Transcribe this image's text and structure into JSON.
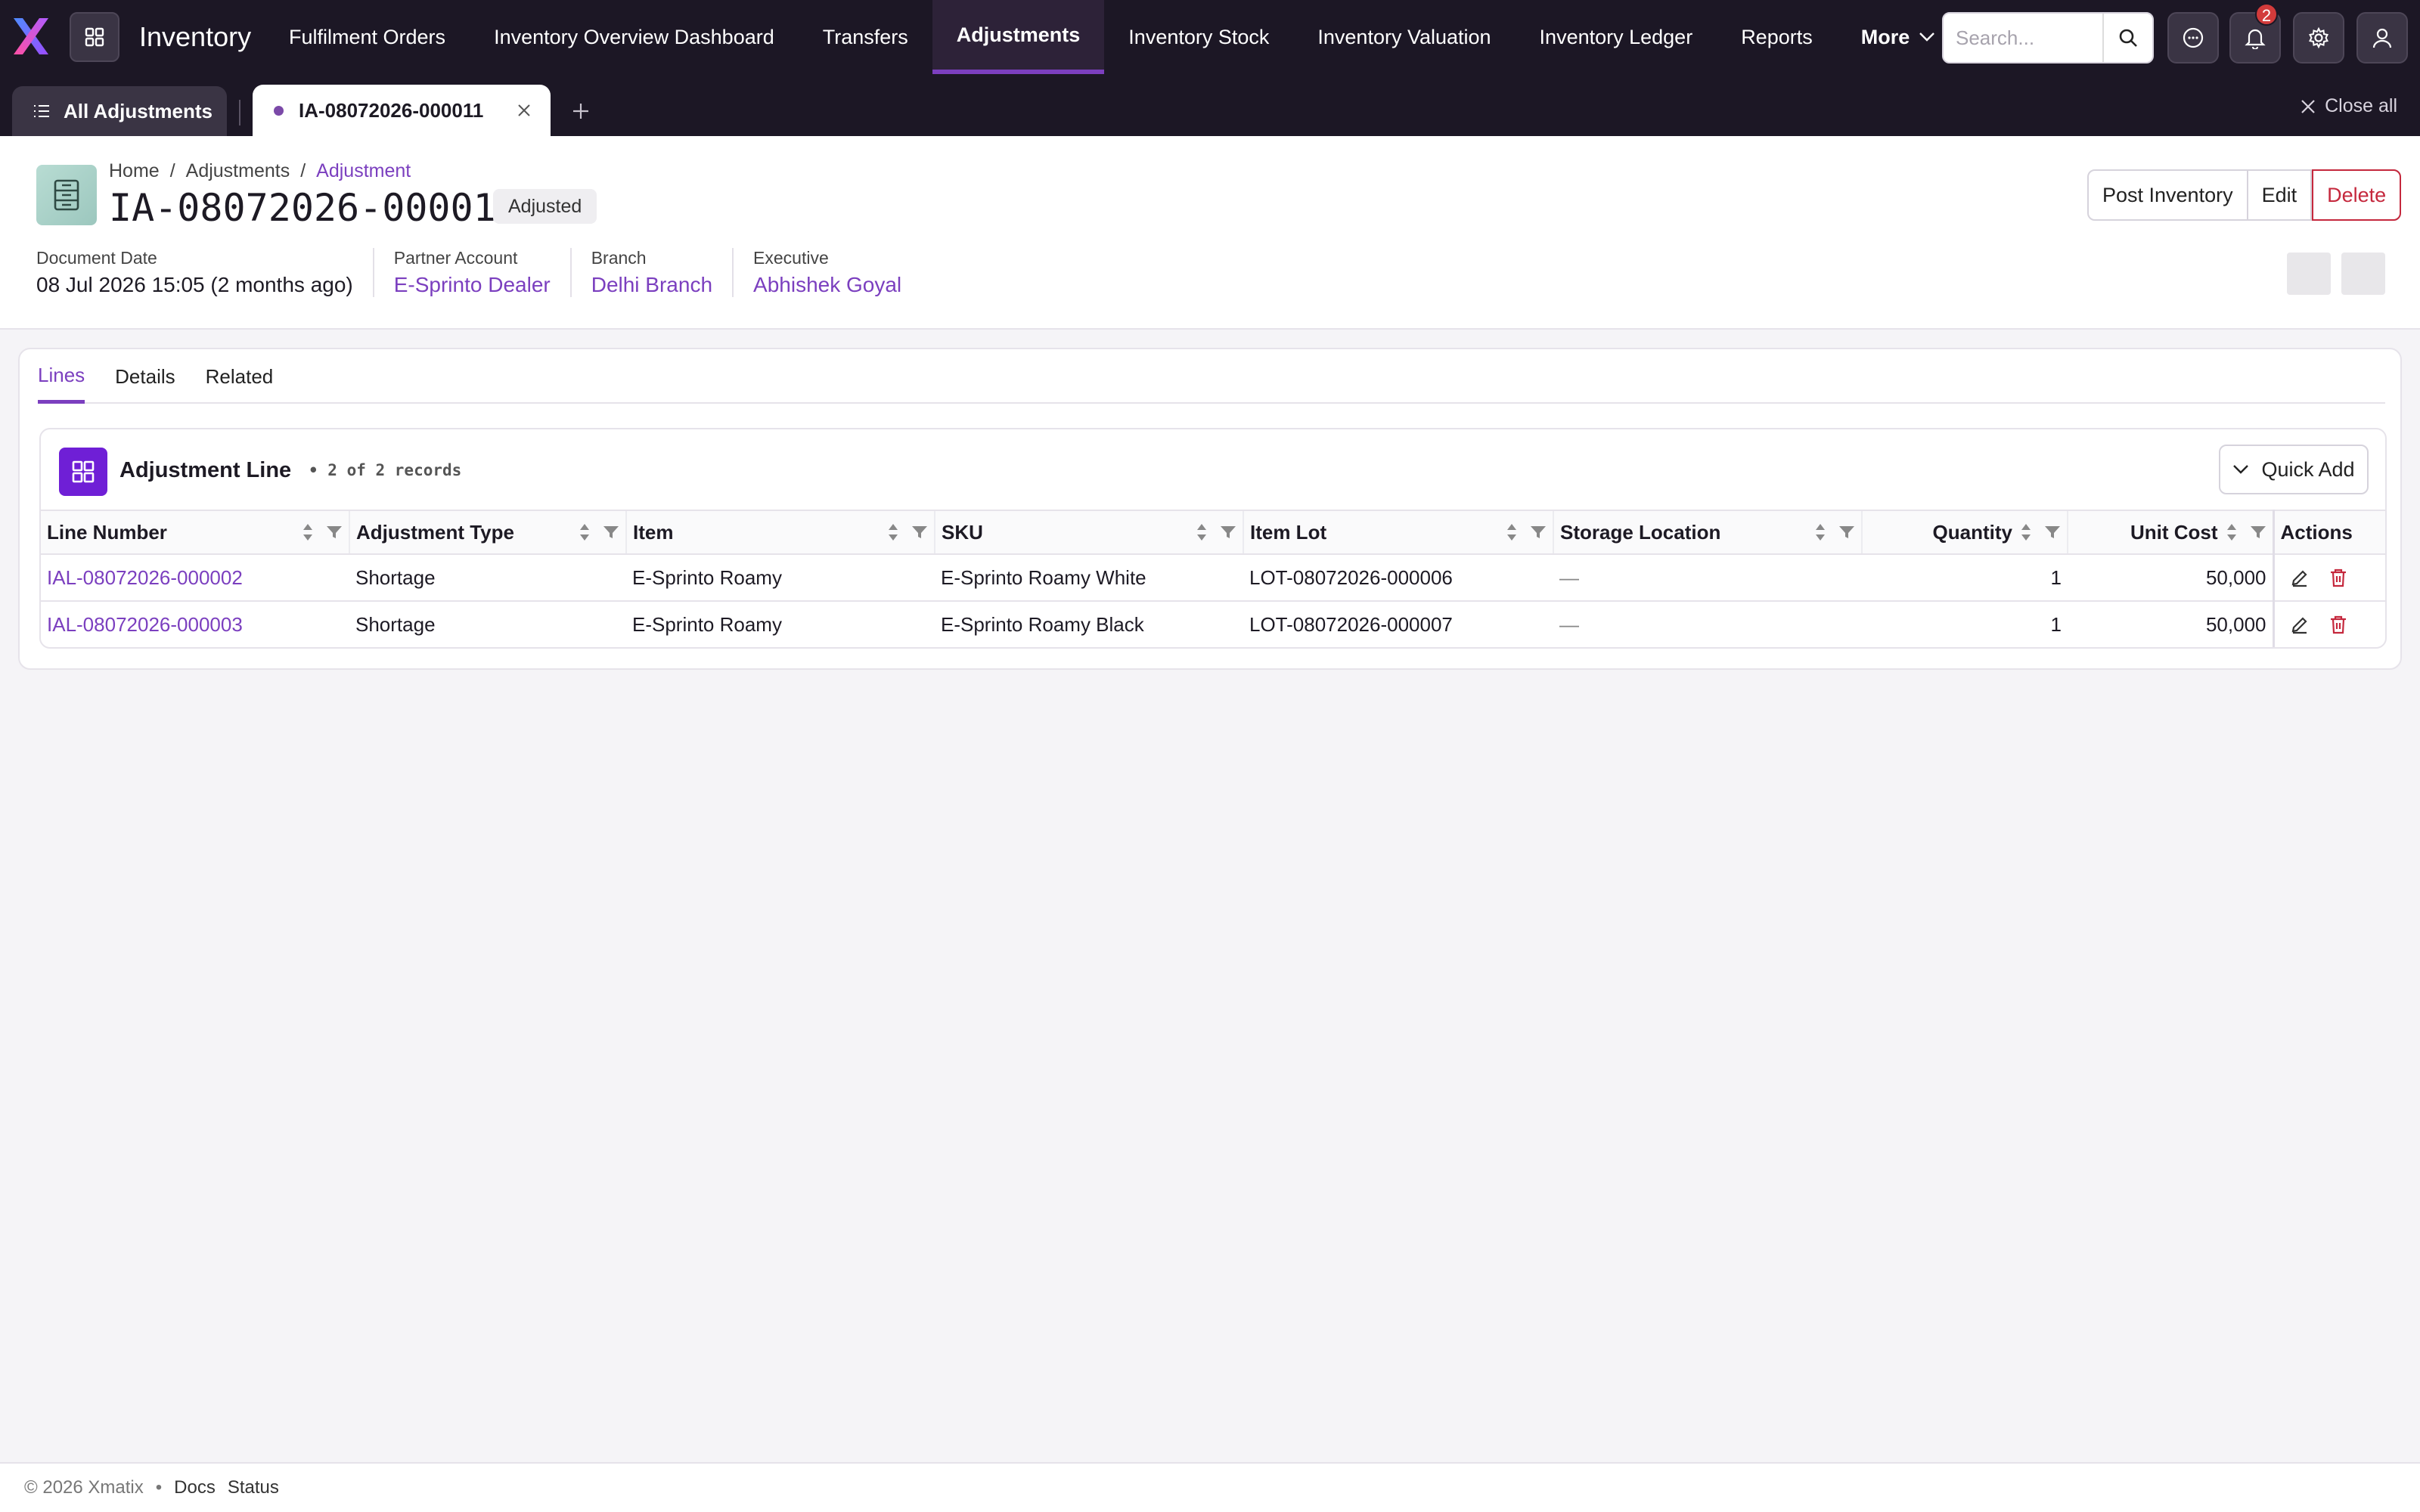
{
  "app": {
    "title": "Inventory"
  },
  "nav": {
    "items": [
      {
        "label": "Fulfilment Orders"
      },
      {
        "label": "Inventory Overview Dashboard"
      },
      {
        "label": "Transfers"
      },
      {
        "label": "Adjustments",
        "active": true
      },
      {
        "label": "Inventory Stock"
      },
      {
        "label": "Inventory Valuation"
      },
      {
        "label": "Inventory Ledger"
      },
      {
        "label": "Reports"
      }
    ],
    "more_label": "More"
  },
  "search": {
    "placeholder": "Search..."
  },
  "notifications": {
    "count": "2"
  },
  "tabs_bar": {
    "all_label": "All Adjustments",
    "open_tab": "IA-08072026-000011",
    "close_all": "Close all"
  },
  "breadcrumb": {
    "home": "Home",
    "section": "Adjustments",
    "current": "Adjustment"
  },
  "document": {
    "number": "IA-08072026-000011",
    "status": "Adjusted",
    "actions": {
      "post": "Post Inventory",
      "edit": "Edit",
      "delete": "Delete"
    },
    "meta": [
      {
        "label": "Document Date",
        "value": "08 Jul 2026 15:05 (2 months ago)"
      },
      {
        "label": "Partner Account",
        "value": "E-Sprinto Dealer"
      },
      {
        "label": "Branch",
        "value": "Delhi Branch"
      },
      {
        "label": "Executive",
        "value": "Abhishek Goyal"
      }
    ]
  },
  "detail_tabs": [
    "Lines",
    "Details",
    "Related"
  ],
  "lines_panel": {
    "title": "Adjustment Line",
    "count": "• 2 of 2 records",
    "quick_add": "Quick Add",
    "columns": [
      "Line Number",
      "Adjustment Type",
      "Item",
      "SKU",
      "Item Lot",
      "Storage Location",
      "Quantity",
      "Unit Cost",
      "Actions"
    ],
    "rows": [
      [
        "IAL-08072026-000002",
        "Shortage",
        "E-Sprinto Roamy",
        "E-Sprinto Roamy White",
        "LOT-08072026-000006",
        "—",
        "1",
        "50,000"
      ],
      [
        "IAL-08072026-000003",
        "Shortage",
        "E-Sprinto Roamy",
        "E-Sprinto Roamy Black",
        "LOT-08072026-000007",
        "—",
        "1",
        "50,000"
      ]
    ]
  },
  "footer": {
    "copyright": "© 2026 Xmatix",
    "sep": "•",
    "docs": "Docs",
    "status": "Status"
  },
  "colors": {
    "accent": "#7b3fbf",
    "topbar": "#1c1725",
    "danger": "#c5283d"
  }
}
